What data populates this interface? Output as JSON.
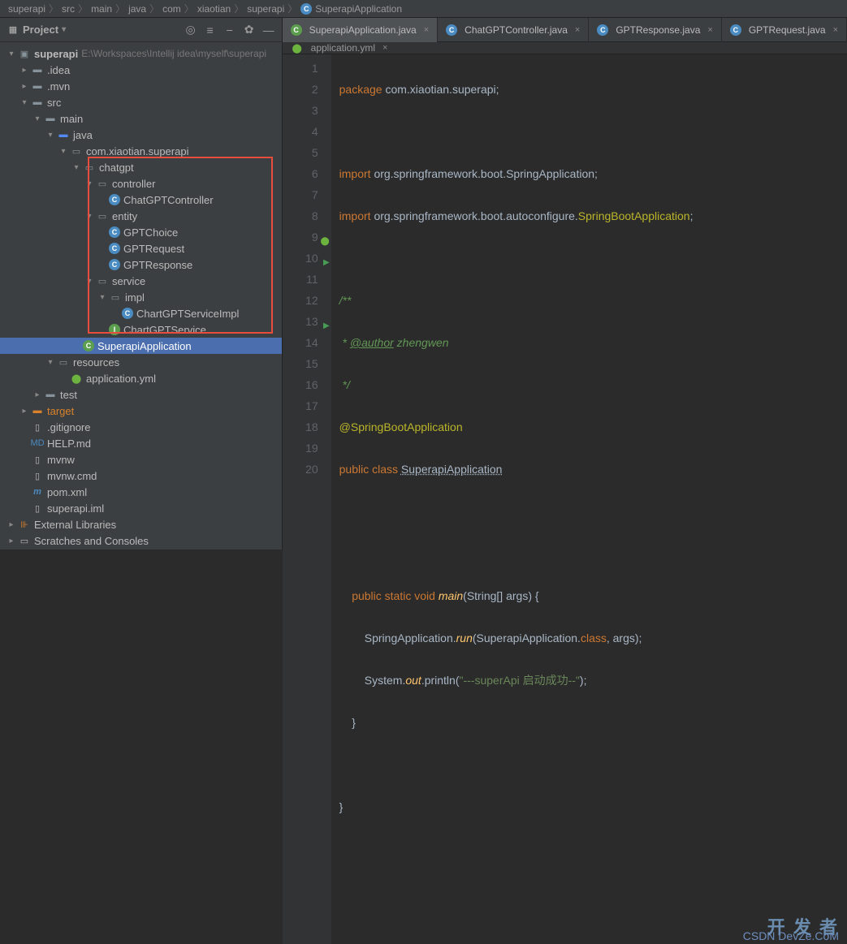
{
  "breadcrumbs": [
    "superapi",
    "src",
    "main",
    "java",
    "com",
    "xiaotian",
    "superapi",
    "SuperapiApplication"
  ],
  "panel": {
    "title": "Project"
  },
  "tree": {
    "root": "superapi",
    "rootPath": "E:\\Workspaces\\Intellij idea\\myself\\superapi",
    "idea": ".idea",
    "mvn": ".mvn",
    "src": "src",
    "main": "main",
    "java": "java",
    "pkg": "com.xiaotian.superapi",
    "chatgpt": "chatgpt",
    "controller": "controller",
    "ChatGPTController": "ChatGPTController",
    "entity": "entity",
    "GPTChoice": "GPTChoice",
    "GPTRequest": "GPTRequest",
    "GPTResponse": "GPTResponse",
    "service": "service",
    "impl": "impl",
    "ChartGPTServiceImpl": "ChartGPTServiceImpl",
    "ChartGPTService": "ChartGPTService",
    "SuperapiApplication": "SuperapiApplication",
    "resources": "resources",
    "applicationyml": "application.yml",
    "test": "test",
    "target": "target",
    "gitignore": ".gitignore",
    "helpmd": "HELP.md",
    "mvnw": "mvnw",
    "mvnwcmd": "mvnw.cmd",
    "pomxml": "pom.xml",
    "superapiiml": "superapi.iml",
    "extlib": "External Libraries",
    "scratches": "Scratches and Consoles"
  },
  "tabs": {
    "t1": "SuperapiApplication.java",
    "t2": "ChatGPTController.java",
    "t3": "GPTResponse.java",
    "t4": "GPTRequest.java",
    "sub": "application.yml"
  },
  "code": {
    "l1_kw": "package ",
    "l1_pkg": "com.xiaotian.superapi",
    "l3_kw": "import ",
    "l3_pkg": "org.springframework.boot.SpringApplication",
    "l4_kw": "import ",
    "l4_pkg": "org.springframework.boot.autoconfigure.",
    "l4_cls": "SpringBootApplication",
    "l6": "/**",
    "l7a": " * ",
    "l7tag": "@author",
    "l7b": " zhengwen",
    "l8": " */",
    "l9": "@SpringBootApplication",
    "l10_kw1": "public class ",
    "l10_cls": "SuperapiApplication",
    " l10_br": " {",
    "l13_kw": "public static void ",
    "l13_fn": "main",
    "l13_p1": "(String[] ",
    "l13_ar": "args",
    "l13_p2": ") {",
    "l14a": "SpringApplication.",
    "l14fn": "run",
    "l14b": "(SuperapiApplication.",
    "l14kw": "class",
    "l14c": ", ",
    "l14ar": "args",
    "l14d": ");",
    "l15a": "System.",
    "l15fn": "out",
    "l15b": ".println(",
    "l15str": "\"---superApi 启动成功--\"",
    "l15c": ");",
    "l16": "}",
    "l18": "}"
  },
  "lines": [
    "1",
    "2",
    "3",
    "4",
    "5",
    "6",
    "7",
    "8",
    "9",
    "10",
    "11",
    "12",
    "13",
    "14",
    "15",
    "16",
    "17",
    "18",
    "19",
    "20"
  ],
  "watermark": {
    "top": "开 发 者",
    "bottom": "CSDN DevZe.CoM"
  }
}
